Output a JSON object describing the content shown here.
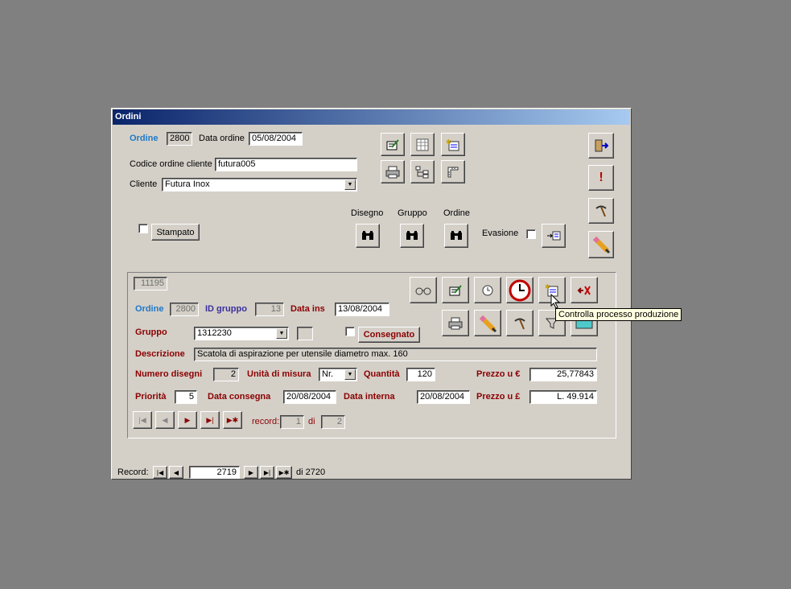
{
  "window": {
    "title": "Ordini"
  },
  "header": {
    "ordine_label": "Ordine",
    "ordine_value": "2800",
    "data_ordine_label": "Data ordine",
    "data_ordine_value": "05/08/2004",
    "codice_label": "Codice ordine cliente",
    "codice_value": "futura005",
    "cliente_label": "Cliente",
    "cliente_value": "Futura Inox",
    "stampato_label": "Stampato",
    "disegno_label": "Disegno",
    "gruppo_label": "Gruppo",
    "ordine_search_label": "Ordine",
    "evasione_label": "Evasione"
  },
  "detail": {
    "id_value": "11195",
    "ordine_label": "Ordine",
    "ordine_value": "2800",
    "id_gruppo_label": "ID gruppo",
    "id_gruppo_value": "13",
    "data_ins_label": "Data ins",
    "data_ins_value": "13/08/2004",
    "gruppo_label": "Gruppo",
    "gruppo_value": "1312230",
    "consegnato_label": "Consegnato",
    "descrizione_label": "Descrizione",
    "descrizione_value": "Scatola di aspirazione per utensile diametro max. 160",
    "numero_disegni_label": "Numero disegni",
    "numero_disegni_value": "2",
    "unita_label": "Unità di misura",
    "unita_value": "Nr.",
    "quantita_label": "Quantità",
    "quantita_value": "120",
    "prezzo_euro_label": "Prezzo u €",
    "prezzo_euro_value": "25,77843",
    "priorita_label": "Priorità",
    "priorita_value": "5",
    "data_consegna_label": "Data consegna",
    "data_consegna_value": "20/08/2004",
    "data_interna_label": "Data interna",
    "data_interna_value": "20/08/2004",
    "prezzo_lire_label": "Prezzo u £",
    "prezzo_lire_value": "L. 49.914",
    "record_label": "record:",
    "record_value": "1",
    "di_label": "di",
    "di_value": "2"
  },
  "tooltip": {
    "text": "Controlla processo produzione"
  },
  "footer": {
    "record_label": "Record:",
    "record_value": "2719",
    "total_label": "di 2720"
  }
}
